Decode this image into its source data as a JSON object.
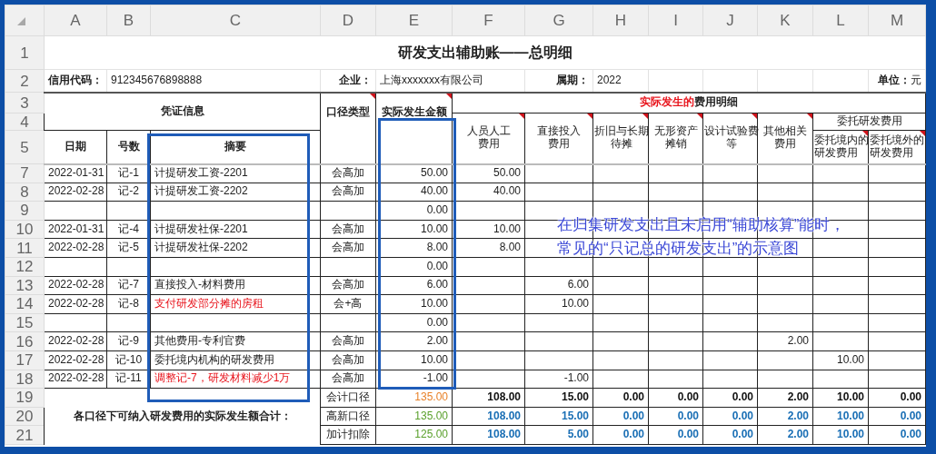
{
  "columns": [
    "A",
    "B",
    "C",
    "D",
    "E",
    "F",
    "G",
    "H",
    "I",
    "J",
    "K",
    "L",
    "M"
  ],
  "header_rows": [
    "1",
    "2",
    "3",
    "4",
    "5"
  ],
  "title": "研发支出辅助账——总明细",
  "info": {
    "credit_label": "信用代码：",
    "credit_value": "912345676898888",
    "company_label": "企业：",
    "company_value": "上海xxxxxxx有限公司",
    "period_label": "属期：",
    "period_value": "2022",
    "unit": "**单位：**元"
  },
  "header": {
    "voucher": "凭证信息",
    "date": "日期",
    "number": "号数",
    "summary": "摘要",
    "caliber": {
      "label": "口径类型",
      "comment": true
    },
    "amount": {
      "label": "实际发生金额",
      "comment": true
    },
    "detail_group": {
      "highlight": "实际发生的",
      "text": "费用明细"
    },
    "expense_columns": [
      {
        "label": "人员人工费用",
        "comment": true
      },
      {
        "label": "直接投入费用",
        "comment": true
      },
      {
        "label": "折旧与长期待摊",
        "comment": true
      },
      {
        "label": "无形资产摊销",
        "comment": true
      },
      {
        "label": "设计试验费等",
        "comment": true
      },
      {
        "label": "其他相关费用",
        "comment": true
      }
    ],
    "entrust": {
      "label": "委托研发费用",
      "columns": [
        {
          "label": "委托境内的研发费用",
          "comment": true
        },
        {
          "label": "委托境外的研发费用",
          "comment": true
        }
      ]
    }
  },
  "rows": [
    {
      "row": "7",
      "date": "2022-01-31",
      "number": "记-1",
      "summary": "计提研发工资-2201",
      "highlight": false,
      "caliber": "会高加",
      "amount": "50.00",
      "expenses": {
        "F": "50.00"
      }
    },
    {
      "row": "8",
      "date": "2022-02-28",
      "number": "记-2",
      "summary": "计提研发工资-2202",
      "highlight": false,
      "caliber": "会高加",
      "amount": "40.00",
      "expenses": {
        "F": "40.00"
      }
    },
    {
      "row": "9",
      "amount": "0.00"
    },
    {
      "row": "10",
      "date": "2022-01-31",
      "number": "记-4",
      "summary": "计提研发社保-2201",
      "highlight": false,
      "caliber": "会高加",
      "amount": "10.00",
      "expenses": {
        "F": "10.00"
      }
    },
    {
      "row": "11",
      "date": "2022-02-28",
      "number": "记-5",
      "summary": "计提研发社保-2202",
      "highlight": false,
      "caliber": "会高加",
      "amount": "8.00",
      "expenses": {
        "F": "8.00"
      }
    },
    {
      "row": "12",
      "amount": "0.00"
    },
    {
      "row": "13",
      "date": "2022-02-28",
      "number": "记-7",
      "summary": "直接投入-材料费用",
      "highlight": false,
      "caliber": "会高加",
      "amount": "6.00",
      "expenses": {
        "G": "6.00"
      }
    },
    {
      "row": "14",
      "date": "2022-02-28",
      "number": "记-8",
      "summary": "支付研发部分摊的房租",
      "highlight": true,
      "caliber": "会+高",
      "amount": "10.00",
      "expenses": {
        "G": "10.00"
      }
    },
    {
      "row": "15",
      "amount": "0.00"
    },
    {
      "row": "16",
      "date": "2022-02-28",
      "number": "记-9",
      "summary": "其他费用-专利官费",
      "highlight": false,
      "caliber": "会高加",
      "amount": "2.00",
      "expenses": {
        "K": "2.00"
      }
    },
    {
      "row": "17",
      "date": "2022-02-28",
      "number": "记-10",
      "summary": "委托境内机构的研发费用",
      "highlight": false,
      "caliber": "会高加",
      "amount": "10.00",
      "expenses": {
        "L": "10.00"
      }
    },
    {
      "row": "18",
      "date": "2022-02-28",
      "number": "记-11",
      "summary": "调整记-7，研发材料减少1万",
      "highlight": true,
      "caliber": "会高加",
      "amount": "-1.00",
      "expenses": {
        "G": "-1.00"
      }
    }
  ],
  "totals": {
    "label": "各口径下可纳入研发费用的实际发生额合计：",
    "lines": [
      {
        "row": "19",
        "caliber": "会计口径",
        "amount": {
          "value": "135.00",
          "color": "#e8822a"
        },
        "color": "#111111",
        "values": [
          "108.00",
          "15.00",
          "0.00",
          "0.00",
          "0.00",
          "2.00",
          "10.00",
          "0.00"
        ]
      },
      {
        "row": "20",
        "caliber": "高新口径",
        "amount": {
          "value": "135.00",
          "color": "#5aa02c"
        },
        "color": "#1a6fb5",
        "values": [
          "108.00",
          "15.00",
          "0.00",
          "0.00",
          "0.00",
          "2.00",
          "10.00",
          "0.00"
        ]
      },
      {
        "row": "21",
        "caliber": "加计扣除",
        "amount": {
          "value": "125.00",
          "color": "#5aa02c"
        },
        "color": "#1a6fb5",
        "values": [
          "108.00",
          "5.00",
          "0.00",
          "0.00",
          "0.00",
          "2.00",
          "10.00",
          "0.00"
        ]
      }
    ]
  },
  "annotation": [
    "在归集研发支出且未启用“辅助核算”能时，",
    "常见的“只记总的研发支出”的示意图"
  ]
}
